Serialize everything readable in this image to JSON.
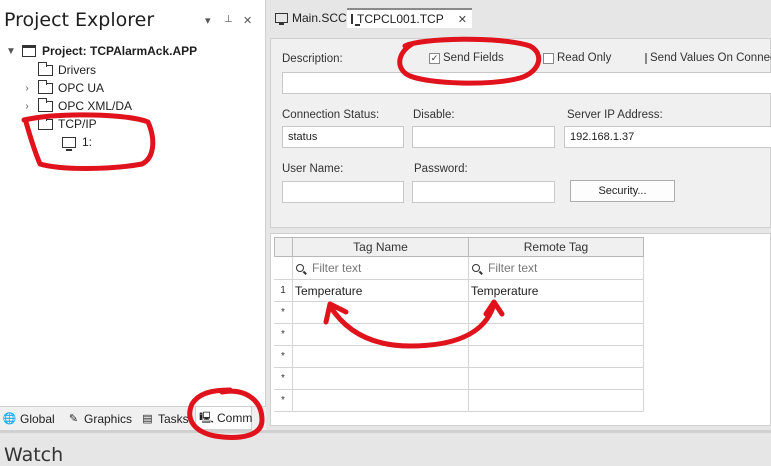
{
  "explorer": {
    "title": "Project Explorer",
    "pin_glyph": "▾",
    "pin2_glyph": "ᵖ",
    "close_glyph": "✕",
    "tree": [
      {
        "label": "Project: TCPAlarmAck.APP",
        "icon": "project-icon",
        "expand": "▼"
      },
      {
        "label": "Drivers",
        "icon": "folder-icon",
        "expand": ""
      },
      {
        "label": "OPC UA",
        "icon": "folder-icon",
        "expand": "›"
      },
      {
        "label": "OPC XML/DA",
        "icon": "folder-icon",
        "expand": "›"
      },
      {
        "label": "TCP/IP",
        "icon": "folder-open-icon",
        "expand": "⌄"
      },
      {
        "label": "1:",
        "icon": "monitor-icon",
        "expand": ""
      }
    ],
    "bottom_tabs": [
      {
        "label": "Global",
        "icon": "globe-icon"
      },
      {
        "label": "Graphics",
        "icon": "graphics-icon"
      },
      {
        "label": "Tasks",
        "icon": "tasks-icon"
      },
      {
        "label": "Comm",
        "icon": "comm-icon",
        "active": true
      }
    ]
  },
  "watch": {
    "title": "Watch"
  },
  "doc_tabs": [
    {
      "label": "Main.SCC",
      "icon": "screen-icon"
    },
    {
      "label": "TCPCL001.TCP",
      "icon": "screen-icon",
      "active": true,
      "close": "✕"
    }
  ],
  "form": {
    "description_label": "Description:",
    "description_value": "",
    "send_fields": {
      "label": "Send Fields",
      "checked": true,
      "mark": "✓"
    },
    "read_only": {
      "label": "Read Only",
      "checked": false
    },
    "send_values": {
      "label": "Send Values On Connect",
      "checked": false
    },
    "connection_status_label": "Connection Status:",
    "connection_status_value": "status",
    "disable_label": "Disable:",
    "disable_value": "",
    "server_ip_label": "Server IP Address:",
    "server_ip_value": "192.168.1.37",
    "user_name_label": "User Name:",
    "user_name_value": "",
    "password_label": "Password:",
    "password_value": "",
    "security_button": "Security..."
  },
  "grid": {
    "columns": [
      "Tag Name",
      "Remote Tag"
    ],
    "filter_placeholder": "Filter text",
    "rows": [
      {
        "marker": "1",
        "tag_name": "Temperature",
        "remote_tag": "Temperature"
      },
      {
        "marker": "*",
        "tag_name": "",
        "remote_tag": ""
      },
      {
        "marker": "*",
        "tag_name": "",
        "remote_tag": ""
      },
      {
        "marker": "*",
        "tag_name": "",
        "remote_tag": ""
      },
      {
        "marker": "*",
        "tag_name": "",
        "remote_tag": ""
      },
      {
        "marker": "*",
        "tag_name": "",
        "remote_tag": ""
      }
    ]
  },
  "annotation_color": "#e0121b"
}
